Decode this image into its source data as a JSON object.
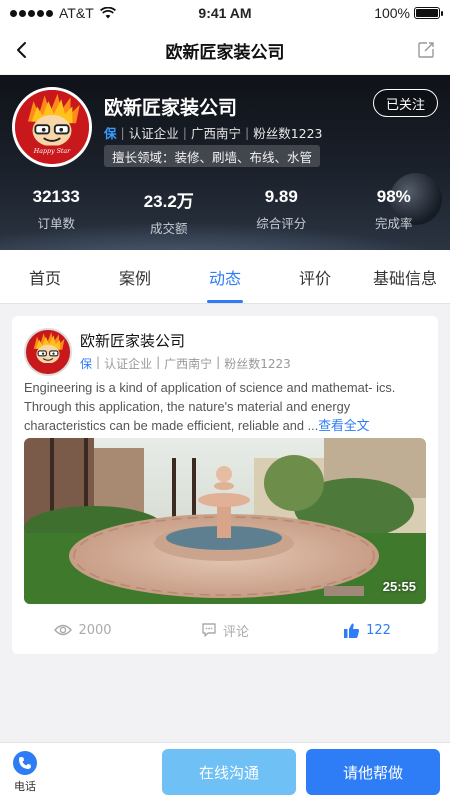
{
  "status_bar": {
    "carrier": "AT&T",
    "time": "9:41 AM",
    "battery": "100%",
    "battery_level": 1.0
  },
  "nav": {
    "title": "欧新匠家装公司",
    "back_icon": "back-arrow-icon",
    "edit_icon": "edit-icon"
  },
  "company": {
    "name": "欧新匠家装公司",
    "follow_label": "已关注",
    "bao_badge": "保",
    "certified": "认证企业",
    "location": "广西南宁",
    "fans": "粉丝数1223",
    "specialty": "擅长领域：装修、刷墙、布线、水管",
    "logo_text": "Happy Star",
    "stats": [
      {
        "value": "32133",
        "label": "订单数"
      },
      {
        "value": "23.2万",
        "label": "成交额"
      },
      {
        "value": "9.89",
        "label": "综合评分"
      },
      {
        "value": "98%",
        "label": "完成率"
      }
    ]
  },
  "tabs": [
    {
      "label": "首页"
    },
    {
      "label": "案例"
    },
    {
      "label": "动态"
    },
    {
      "label": "评价"
    },
    {
      "label": "基础信息"
    }
  ],
  "active_tab": "动态",
  "post": {
    "name": "欧新匠家装公司",
    "bao_badge": "保",
    "certified": "认证企业",
    "location": "广西南宁",
    "fans": "粉丝数1223",
    "text": "Engineering is a kind of application of science and mathemat- ics. Through this application, the nature's material and energy characteristics can be made efficient, reliable and ...",
    "more_label": "查看全文",
    "duration": "25:55",
    "views": "2000",
    "comment_label": "评论",
    "likes": "122"
  },
  "bottom": {
    "phone_label": "电话",
    "chat_label": "在线沟通",
    "help_label": "请他帮做"
  },
  "colors": {
    "accent": "#2e7cf6",
    "accent_light": "#6fc0f5",
    "brand_red": "#c8181c"
  }
}
